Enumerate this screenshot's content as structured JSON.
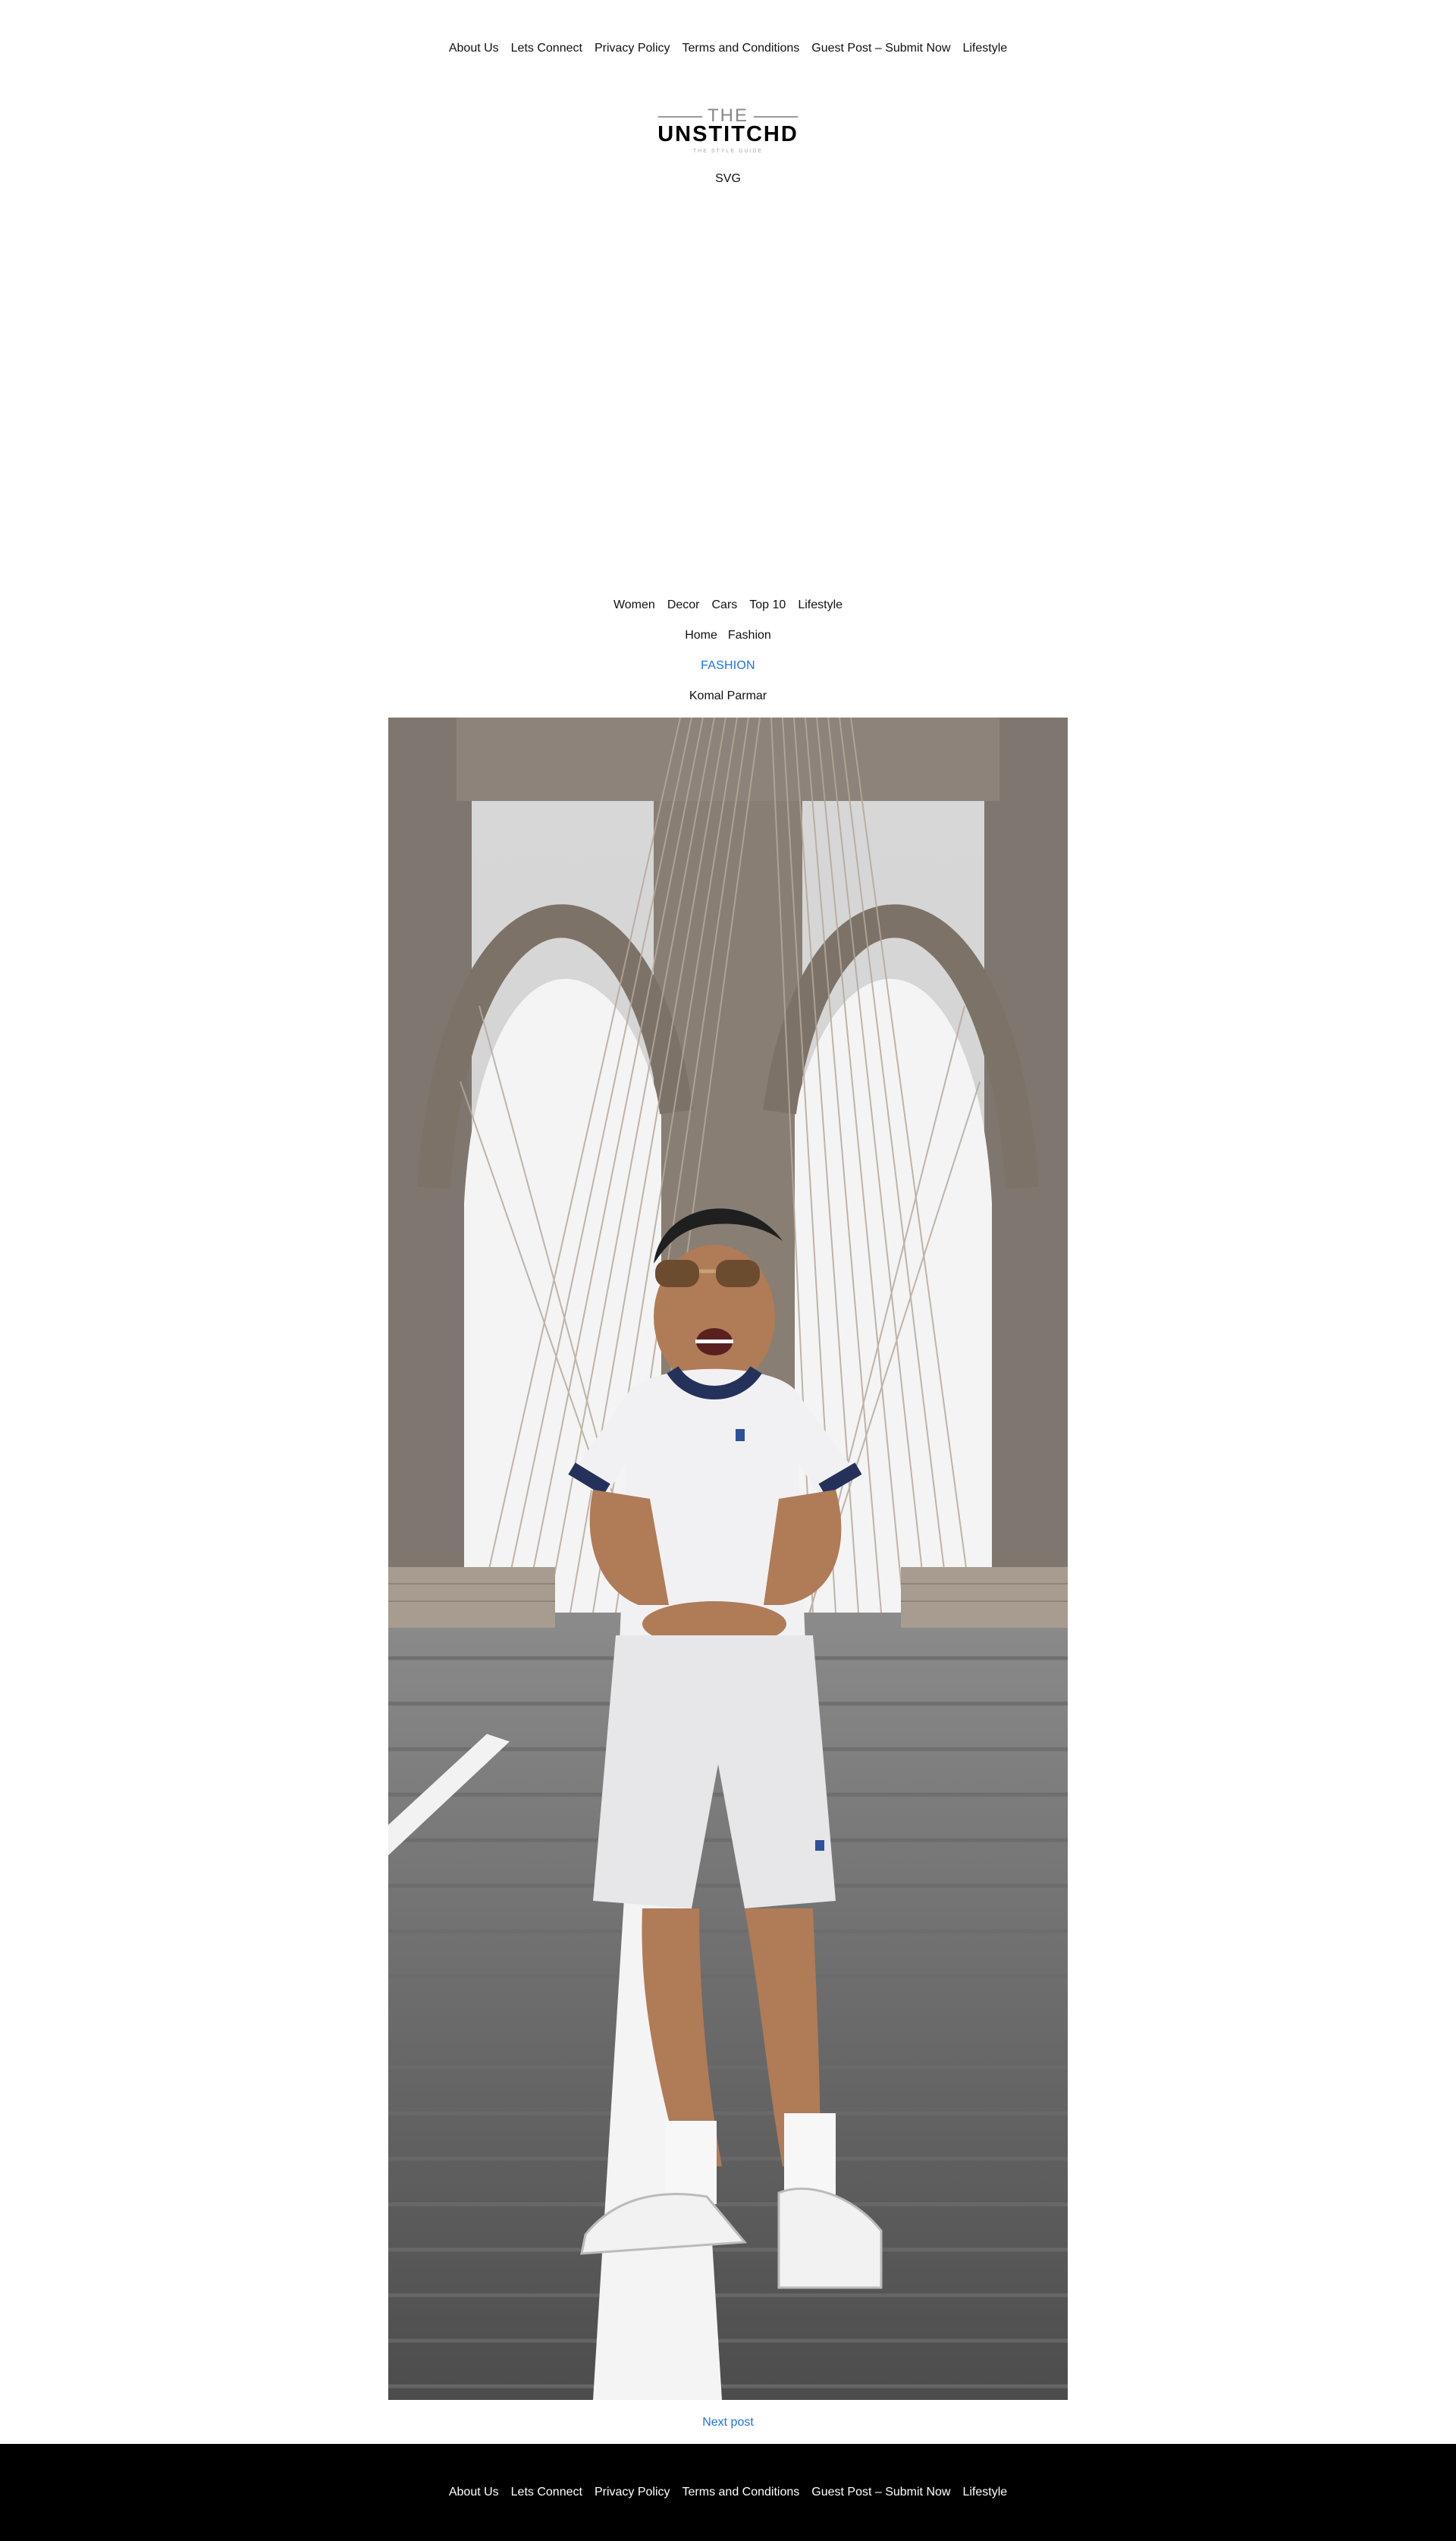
{
  "top_nav": {
    "items": [
      {
        "label": "About Us"
      },
      {
        "label": "Lets Connect"
      },
      {
        "label": "Privacy Policy"
      },
      {
        "label": "Terms and Conditions"
      },
      {
        "label": "Guest Post – Submit Now"
      },
      {
        "label": "Lifestyle"
      }
    ]
  },
  "logo": {
    "top_text": "THE",
    "main_text": "UNSTITCHD",
    "sub_text": "THE STYLE GUIDE"
  },
  "svg_label": "SVG",
  "category_nav": {
    "items": [
      {
        "label": "Women"
      },
      {
        "label": "Decor"
      },
      {
        "label": "Cars"
      },
      {
        "label": "Top 10"
      },
      {
        "label": "Lifestyle"
      }
    ]
  },
  "breadcrumb": {
    "items": [
      {
        "label": "Home"
      },
      {
        "label": "Fashion"
      }
    ]
  },
  "category": {
    "label": "FASHION"
  },
  "author": {
    "name": "Komal Parmar"
  },
  "hero": {
    "alt": "Man in white t-shirt and shorts laughing on bridge walkway"
  },
  "next_post": {
    "label": "Next post"
  },
  "footer_nav": {
    "items": [
      {
        "label": "About Us"
      },
      {
        "label": "Lets Connect"
      },
      {
        "label": "Privacy Policy"
      },
      {
        "label": "Terms and Conditions"
      },
      {
        "label": "Guest Post – Submit Now"
      },
      {
        "label": "Lifestyle"
      }
    ]
  },
  "colors": {
    "link": "#1a73e8",
    "footer_bg": "#000000",
    "text": "#111111"
  }
}
